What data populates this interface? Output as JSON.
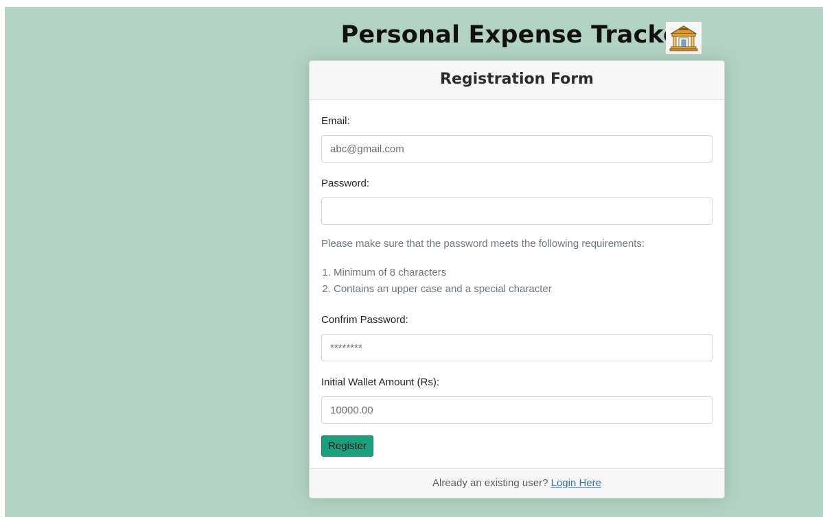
{
  "app": {
    "title": "Personal Expense Tracker",
    "icon": "bank-building-icon",
    "background_color": "#b2d3c4"
  },
  "form": {
    "title": "Registration Form",
    "email": {
      "label": "Email:",
      "placeholder": "abc@gmail.com",
      "value": ""
    },
    "password": {
      "label": "Password:",
      "placeholder": "",
      "value": ""
    },
    "password_help": "Please make sure that the password meets the following requirements:",
    "requirements": [
      "Minimum of 8 characters",
      "Contains an upper case and a special character"
    ],
    "confirm_password": {
      "label": "Confrim Password:",
      "placeholder": "********",
      "value": ""
    },
    "wallet": {
      "label": "Initial Wallet Amount (Rs):",
      "placeholder": "10000.00",
      "value": ""
    },
    "register_button": "Register",
    "button_color": "#1aa07f"
  },
  "footer": {
    "text": "Already an existing user?",
    "link_text": "Login Here",
    "link_color": "#2f6ebd"
  }
}
